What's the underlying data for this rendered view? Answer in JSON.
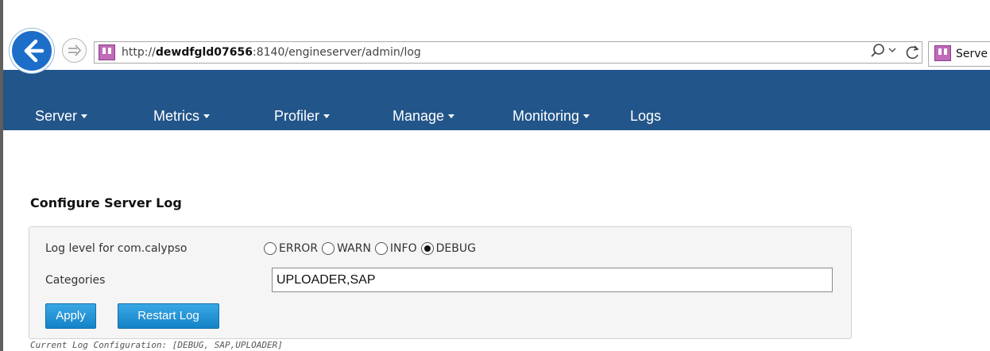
{
  "browser": {
    "url_scheme": "http://",
    "url_host": "dewdfgld07656",
    "url_rest": ":8140/engineserver/admin/log",
    "tab_title": "Serve",
    "icons": [
      "back-icon",
      "forward-icon",
      "site-favicon",
      "search-icon",
      "dropdown-arrow-icon",
      "refresh-icon"
    ]
  },
  "nav": {
    "items": [
      {
        "label": "Server",
        "dropdown": true
      },
      {
        "label": "Metrics",
        "dropdown": true
      },
      {
        "label": "Profiler",
        "dropdown": true
      },
      {
        "label": "Manage",
        "dropdown": true
      },
      {
        "label": "Monitoring",
        "dropdown": true
      },
      {
        "label": "Logs",
        "dropdown": false
      }
    ]
  },
  "page": {
    "title": "Configure Server Log"
  },
  "form": {
    "log_level_label": "Log level for com.calypso",
    "levels": [
      {
        "label": "ERROR",
        "checked": false
      },
      {
        "label": "WARN",
        "checked": false
      },
      {
        "label": "INFO",
        "checked": false
      },
      {
        "label": "DEBUG",
        "checked": true
      }
    ],
    "categories_label": "Categories",
    "categories_value": "UPLOADER,SAP",
    "apply_label": "Apply",
    "restart_label": "Restart Log"
  },
  "status": {
    "current_config": "Current Log Configuration: [DEBUG, SAP,UPLOADER]"
  },
  "colors": {
    "nav_bg": "#22558a",
    "button_bg": "#1c8fd6",
    "back_button": "#1c6ec9",
    "panel_bg": "#f5f5f5"
  }
}
